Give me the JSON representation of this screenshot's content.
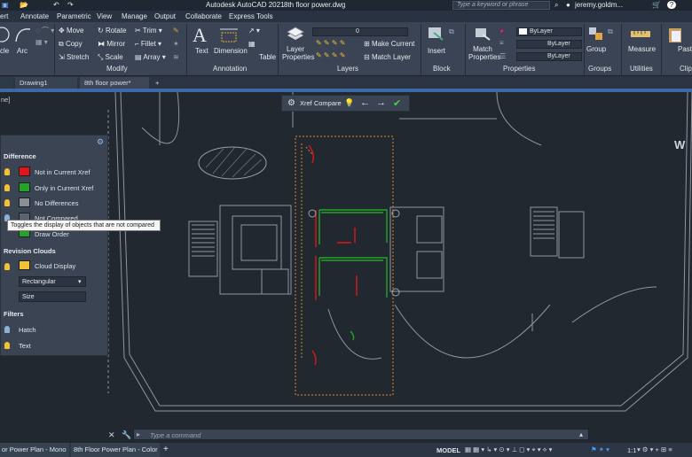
{
  "titlebar": {
    "app_title": "Autodesk AutoCAD 2021",
    "file_title": "8th floor power.dwg",
    "search_placeholder": "Type a keyword or phrase",
    "user": "jeremy.goldm..."
  },
  "menu": [
    "ert",
    "Annotate",
    "Parametric",
    "View",
    "Manage",
    "Output",
    "Collaborate",
    "Express Tools"
  ],
  "ribbon": {
    "modify": {
      "title": "Modify",
      "items": [
        "Move",
        "Rotate",
        "Trim",
        "Copy",
        "Mirror",
        "Fillet",
        "Stretch",
        "Scale",
        "Array"
      ],
      "draw_left": "cle",
      "arc": "Arc"
    },
    "annotation": {
      "title": "Annotation",
      "text": "Text",
      "dimension": "Dimension",
      "table": "Table"
    },
    "layers": {
      "title": "Layers",
      "layer_properties": "Layer Properties",
      "current_layer": "0",
      "make_current": "Make Current",
      "match_layer": "Match Layer"
    },
    "block": {
      "title": "Block",
      "insert": "Insert"
    },
    "properties": {
      "title": "Properties",
      "match_properties": "Match Properties",
      "color": "ByLayer",
      "linetype": "ByLayer",
      "lineweight": "ByLayer"
    },
    "groups": {
      "title": "Groups",
      "group": "Group"
    },
    "utilities": {
      "title": "Utilities",
      "measure": "Measure"
    },
    "clipboard": {
      "title": "Clipb",
      "paste": "Paste"
    }
  },
  "file_tabs": [
    "Drawing1",
    "8th floor power*"
  ],
  "canvas_label": "ne]",
  "xref_compare": {
    "label": "Xref Compare"
  },
  "compare_palette": {
    "difference_heading": "Difference",
    "rows": [
      {
        "label": "Not in Current Xref",
        "color": "#e0161b"
      },
      {
        "label": "Only in Current Xref",
        "color": "#22a524"
      },
      {
        "label": "No Differences",
        "color": "#8a8f96"
      },
      {
        "label": "Not Compared",
        "color": "#5b6270"
      }
    ],
    "draw_order": "Draw Order",
    "revision_heading": "Revision Clouds",
    "cloud_display": "Cloud Display",
    "cloud_color": "#f1c232",
    "cloud_shape": "Rectangular",
    "size_label": "Size",
    "filters_heading": "Filters",
    "filters": [
      "Hatch",
      "Text"
    ]
  },
  "tooltip": "Toggles the display of objects that are not compared",
  "command_line": {
    "placeholder": "Type a command"
  },
  "status": {
    "layout_tabs": [
      "or Power Plan - Mono",
      "8th Floor Power Plan - Color"
    ],
    "space": "MODEL",
    "scale": "1:1"
  }
}
